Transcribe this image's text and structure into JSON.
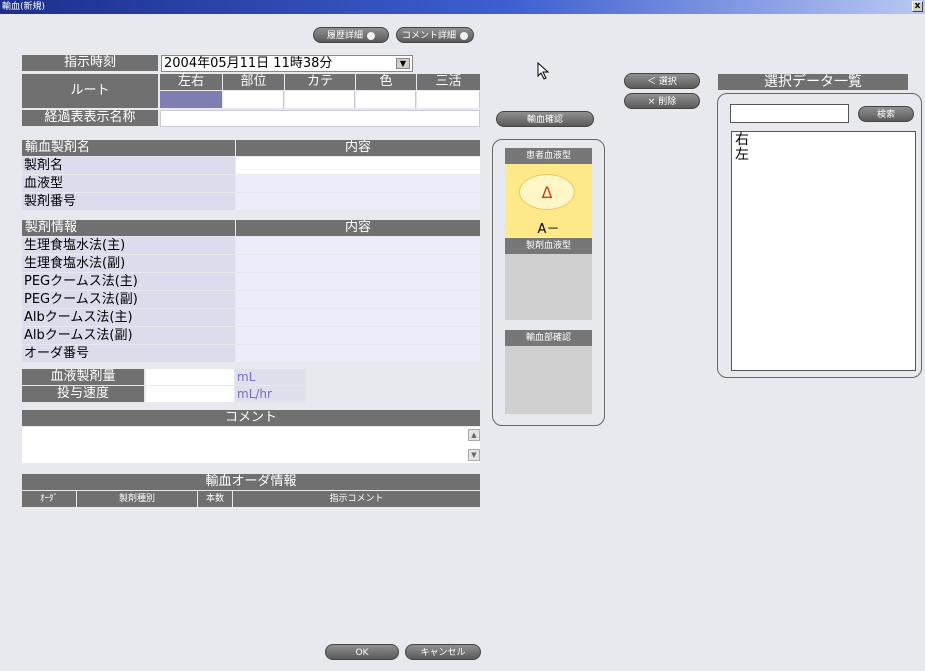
{
  "window": {
    "title": "輸血(新規)",
    "close_label": "x"
  },
  "top_buttons": {
    "history": "履歴詳細",
    "comment": "コメント詳細"
  },
  "order": {
    "time_label": "指示時刻",
    "time_value": "2004年05月11日 11時38分",
    "route_label": "ルート",
    "route_cols": [
      "左右",
      "部位",
      "カテ",
      "色",
      "三活"
    ],
    "display_name_label": "経過表表示名称"
  },
  "product_table": {
    "header_name": "輸血製剤名",
    "header_content": "内容",
    "rows": [
      "製剤名",
      "血液型",
      "製剤番号"
    ]
  },
  "info_table": {
    "header_name": "製剤情報",
    "header_content": "内容",
    "rows": [
      "生理食塩水法(主)",
      "生理食塩水法(副)",
      "PEGクームス法(主)",
      "PEGクームス法(副)",
      "Albクームス法(主)",
      "Albクームス法(副)",
      "オーダ番号"
    ]
  },
  "dose": {
    "amount_label": "血液製剤量",
    "amount_unit": "mL",
    "rate_label": "投与速度",
    "rate_unit": "mL/hr"
  },
  "comment": {
    "header": "コメント"
  },
  "order_info": {
    "header": "輸血オーダ情報",
    "columns": [
      "ｵｰﾀﾞ",
      "製剤種別",
      "本数",
      "指示コメント"
    ]
  },
  "confirm": {
    "button": "輸血確認",
    "patient_type_label": "患者血液型",
    "patient_symbol": "Δ",
    "patient_type_value": "A－",
    "product_type_label": "製剤血液型",
    "dept_confirm_label": "輸血部確認"
  },
  "side_buttons": {
    "select": "＜ 選択",
    "delete": "× 削除"
  },
  "selected_list": {
    "header": "選択データ一覧",
    "search_button": "検索",
    "items": [
      "右",
      "左"
    ]
  },
  "footer": {
    "ok": "OK",
    "cancel": "キャンセル"
  },
  "colors": {
    "titlebar": "#1c2f8c",
    "header_gray": "#707070",
    "patient_highlight": "#fde98a"
  }
}
